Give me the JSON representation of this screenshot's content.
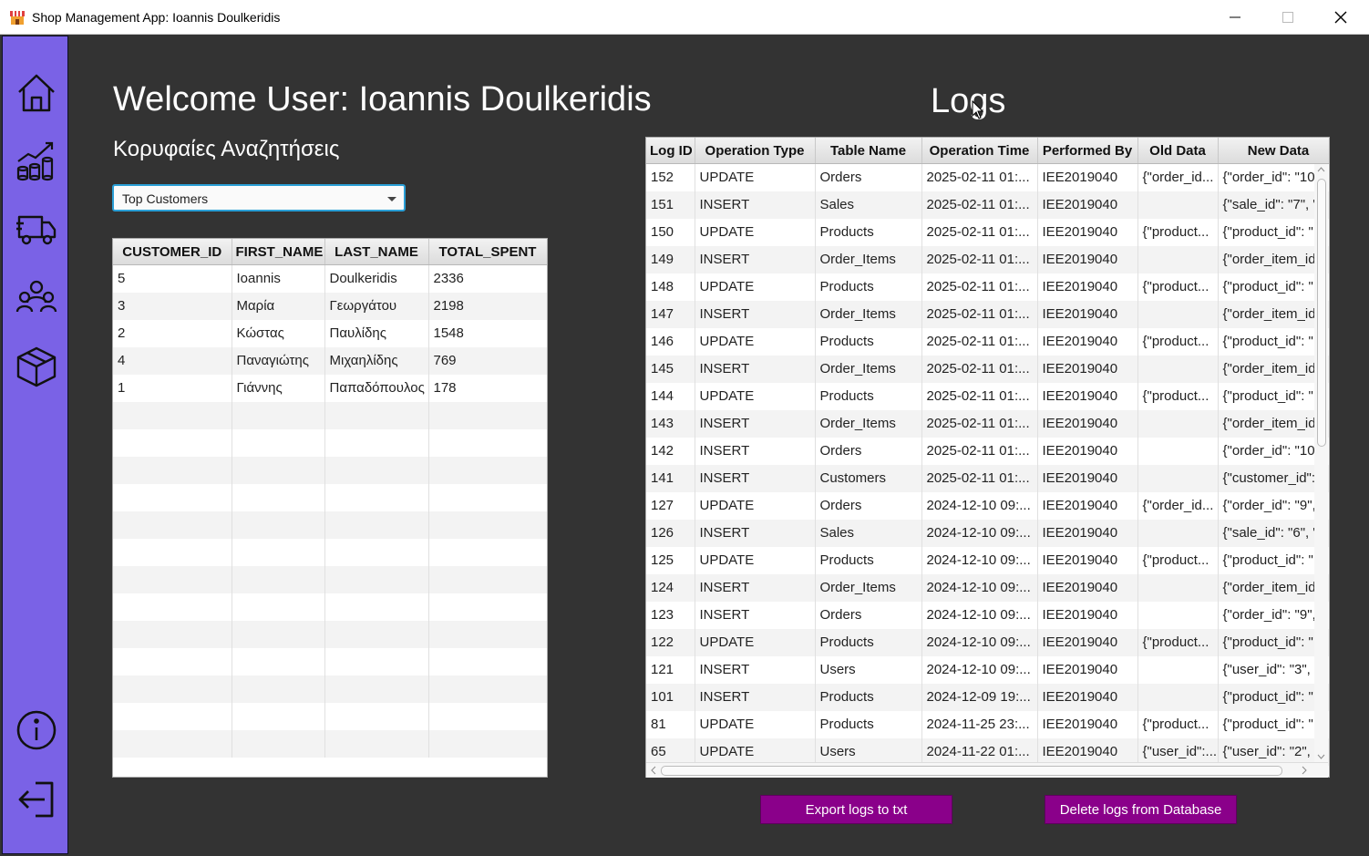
{
  "window": {
    "title": "Shop Management App: Ioannis Doulkeridis",
    "icon": "shop-icon"
  },
  "sidebar": {
    "items": [
      {
        "icon": "home-icon",
        "name": "home"
      },
      {
        "icon": "sales-chart-icon",
        "name": "sales"
      },
      {
        "icon": "delivery-truck-icon",
        "name": "orders"
      },
      {
        "icon": "users-icon",
        "name": "customers"
      },
      {
        "icon": "box-icon",
        "name": "products"
      }
    ],
    "bottom": [
      {
        "icon": "info-icon",
        "name": "info"
      },
      {
        "icon": "logout-icon",
        "name": "logout"
      }
    ],
    "color": "#7a62e6"
  },
  "header": {
    "welcome": "Welcome User: Ioannis Doulkeridis",
    "subtitle": "Κορυφαίες Αναζητήσεις",
    "logs_title": "Logs"
  },
  "query_select": {
    "value": "Top Customers"
  },
  "customers_table": {
    "columns": [
      "CUSTOMER_ID",
      "FIRST_NAME",
      "LAST_NAME",
      "TOTAL_SPENT"
    ],
    "rows": [
      [
        "5",
        "Ioannis",
        "Doulkeridis",
        "2336"
      ],
      [
        "3",
        "Μαρία",
        "Γεωργάτου",
        "2198"
      ],
      [
        "2",
        "Κώστας",
        "Παυλίδης",
        "1548"
      ],
      [
        "4",
        "Παναγιώτης",
        "Μιχαηλίδης",
        "769"
      ],
      [
        "1",
        "Γιάννης",
        "Παπαδόπουλος",
        "178"
      ]
    ]
  },
  "logs_table": {
    "columns": [
      "Log ID",
      "Operation Type",
      "Table Name",
      "Operation Time",
      "Performed By",
      "Old Data",
      "New Data"
    ],
    "rows": [
      [
        "152",
        "UPDATE",
        "Orders",
        "2025-02-11 01:...",
        "IEE2019040",
        "{\"order_id...",
        "{\"order_id\": \"10"
      ],
      [
        "151",
        "INSERT",
        "Sales",
        "2025-02-11 01:...",
        "IEE2019040",
        "",
        "{\"sale_id\": \"7\", \""
      ],
      [
        "150",
        "UPDATE",
        "Products",
        "2025-02-11 01:...",
        "IEE2019040",
        "{\"product...",
        "{\"product_id\": \""
      ],
      [
        "149",
        "INSERT",
        "Order_Items",
        "2025-02-11 01:...",
        "IEE2019040",
        "",
        "{\"order_item_id"
      ],
      [
        "148",
        "UPDATE",
        "Products",
        "2025-02-11 01:...",
        "IEE2019040",
        "{\"product...",
        "{\"product_id\": \""
      ],
      [
        "147",
        "INSERT",
        "Order_Items",
        "2025-02-11 01:...",
        "IEE2019040",
        "",
        "{\"order_item_id"
      ],
      [
        "146",
        "UPDATE",
        "Products",
        "2025-02-11 01:...",
        "IEE2019040",
        "{\"product...",
        "{\"product_id\": \""
      ],
      [
        "145",
        "INSERT",
        "Order_Items",
        "2025-02-11 01:...",
        "IEE2019040",
        "",
        "{\"order_item_id"
      ],
      [
        "144",
        "UPDATE",
        "Products",
        "2025-02-11 01:...",
        "IEE2019040",
        "{\"product...",
        "{\"product_id\": \""
      ],
      [
        "143",
        "INSERT",
        "Order_Items",
        "2025-02-11 01:...",
        "IEE2019040",
        "",
        "{\"order_item_id"
      ],
      [
        "142",
        "INSERT",
        "Orders",
        "2025-02-11 01:...",
        "IEE2019040",
        "",
        "{\"order_id\": \"10"
      ],
      [
        "141",
        "INSERT",
        "Customers",
        "2025-02-11 01:...",
        "IEE2019040",
        "",
        "{\"customer_id\":"
      ],
      [
        "127",
        "UPDATE",
        "Orders",
        "2024-12-10 09:...",
        "IEE2019040",
        "{\"order_id...",
        "{\"order_id\": \"9\","
      ],
      [
        "126",
        "INSERT",
        "Sales",
        "2024-12-10 09:...",
        "IEE2019040",
        "",
        "{\"sale_id\": \"6\", \""
      ],
      [
        "125",
        "UPDATE",
        "Products",
        "2024-12-10 09:...",
        "IEE2019040",
        "{\"product...",
        "{\"product_id\": \""
      ],
      [
        "124",
        "INSERT",
        "Order_Items",
        "2024-12-10 09:...",
        "IEE2019040",
        "",
        "{\"order_item_id"
      ],
      [
        "123",
        "INSERT",
        "Orders",
        "2024-12-10 09:...",
        "IEE2019040",
        "",
        "{\"order_id\": \"9\","
      ],
      [
        "122",
        "UPDATE",
        "Products",
        "2024-12-10 09:...",
        "IEE2019040",
        "{\"product...",
        "{\"product_id\": \""
      ],
      [
        "121",
        "INSERT",
        "Users",
        "2024-12-10 09:...",
        "IEE2019040",
        "",
        "{\"user_id\": \"3\", \""
      ],
      [
        "101",
        "INSERT",
        "Products",
        "2024-12-09 19:...",
        "IEE2019040",
        "",
        "{\"product_id\": \""
      ],
      [
        "81",
        "UPDATE",
        "Products",
        "2024-11-25 23:...",
        "IEE2019040",
        "{\"product...",
        "{\"product_id\": \""
      ],
      [
        "65",
        "UPDATE",
        "Users",
        "2024-11-22 01:...",
        "IEE2019040",
        "{\"user_id\":...",
        "{\"user_id\": \"2\", \""
      ]
    ]
  },
  "buttons": {
    "export": "Export logs to txt",
    "delete": "Delete logs from Database",
    "color": "#8a008a"
  }
}
